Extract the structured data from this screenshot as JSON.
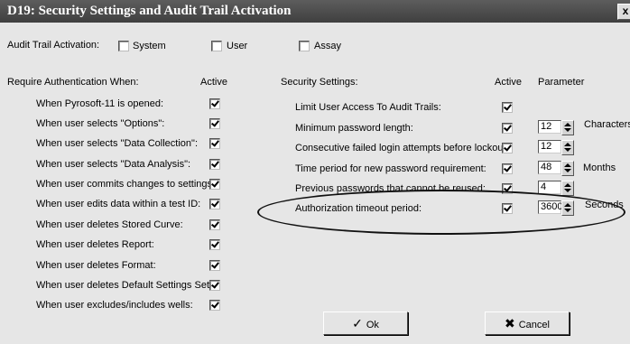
{
  "window": {
    "title": "D19: Security Settings and Audit Trail Activation",
    "close_label": "x"
  },
  "audit": {
    "label": "Audit Trail Activation:",
    "options": [
      {
        "label": "System",
        "checked": false
      },
      {
        "label": "User",
        "checked": false
      },
      {
        "label": "Assay",
        "checked": false
      }
    ]
  },
  "auth": {
    "header": "Require Authentication When:",
    "active_header": "Active",
    "items": [
      {
        "label": "When Pyrosoft-11 is opened:",
        "checked": true
      },
      {
        "label": "When user selects \"Options\":",
        "checked": true
      },
      {
        "label": "When user selects \"Data Collection\":",
        "checked": true
      },
      {
        "label": "When user selects \"Data Analysis\":",
        "checked": true
      },
      {
        "label": "When user commits changes to settings:",
        "checked": true
      },
      {
        "label": "When user edits data within a test ID:",
        "checked": true
      },
      {
        "label": "When user deletes Stored Curve:",
        "checked": true
      },
      {
        "label": "When user deletes Report:",
        "checked": true
      },
      {
        "label": "When user deletes Format:",
        "checked": true
      },
      {
        "label": "When user deletes Default Settings Set:",
        "checked": true
      },
      {
        "label": "When user excludes/includes wells:",
        "checked": true
      }
    ]
  },
  "security": {
    "header": "Security Settings:",
    "active_header": "Active",
    "param_header": "Parameter",
    "items": [
      {
        "label": "Limit User Access To Audit Trails:",
        "checked": true,
        "value": "",
        "unit": ""
      },
      {
        "label": "Minimum password length:",
        "checked": true,
        "value": "12",
        "unit": "Characters"
      },
      {
        "label": "Consecutive failed login attempts before lockout:",
        "checked": true,
        "value": "12",
        "unit": ""
      },
      {
        "label": "Time period for new password requirement:",
        "checked": true,
        "value": "48",
        "unit": "Months"
      },
      {
        "label": "Previous passwords that cannot be reused:",
        "checked": true,
        "value": "4",
        "unit": ""
      },
      {
        "label": "Authorization timeout period:",
        "checked": true,
        "value": "3600",
        "unit": "Seconds"
      }
    ]
  },
  "buttons": {
    "ok": "Ok",
    "cancel": "Cancel"
  }
}
